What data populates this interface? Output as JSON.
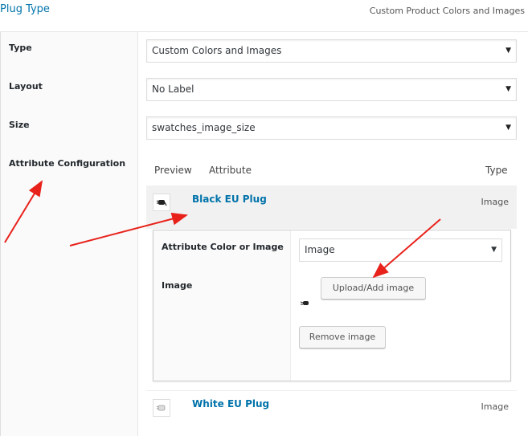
{
  "header": {
    "title": "Plug Type",
    "subtitle": "Custom Product Colors and Images"
  },
  "fields": {
    "type": {
      "label": "Type",
      "value": "Custom Colors and Images"
    },
    "layout": {
      "label": "Layout",
      "value": "No Label"
    },
    "size": {
      "label": "Size",
      "value": "swatches_image_size"
    },
    "attr_config": {
      "label": "Attribute Configuration"
    }
  },
  "attributes": {
    "headers": {
      "preview": "Preview",
      "attribute": "Attribute",
      "type": "Type"
    },
    "rows": [
      {
        "name": "Black EU Plug",
        "type": "Image"
      },
      {
        "name": "White EU Plug",
        "type": "Image"
      }
    ]
  },
  "subpanel": {
    "color_or_image_label": "Attribute Color or Image",
    "color_or_image_value": "Image",
    "image_label": "Image",
    "upload_button": "Upload/Add image",
    "remove_button": "Remove image"
  },
  "colors": {
    "link": "#0073aa",
    "arrow": "#e8221b"
  },
  "icons": {
    "dropdown": "chevron-down-icon",
    "plug_preview": "plug-icon"
  }
}
